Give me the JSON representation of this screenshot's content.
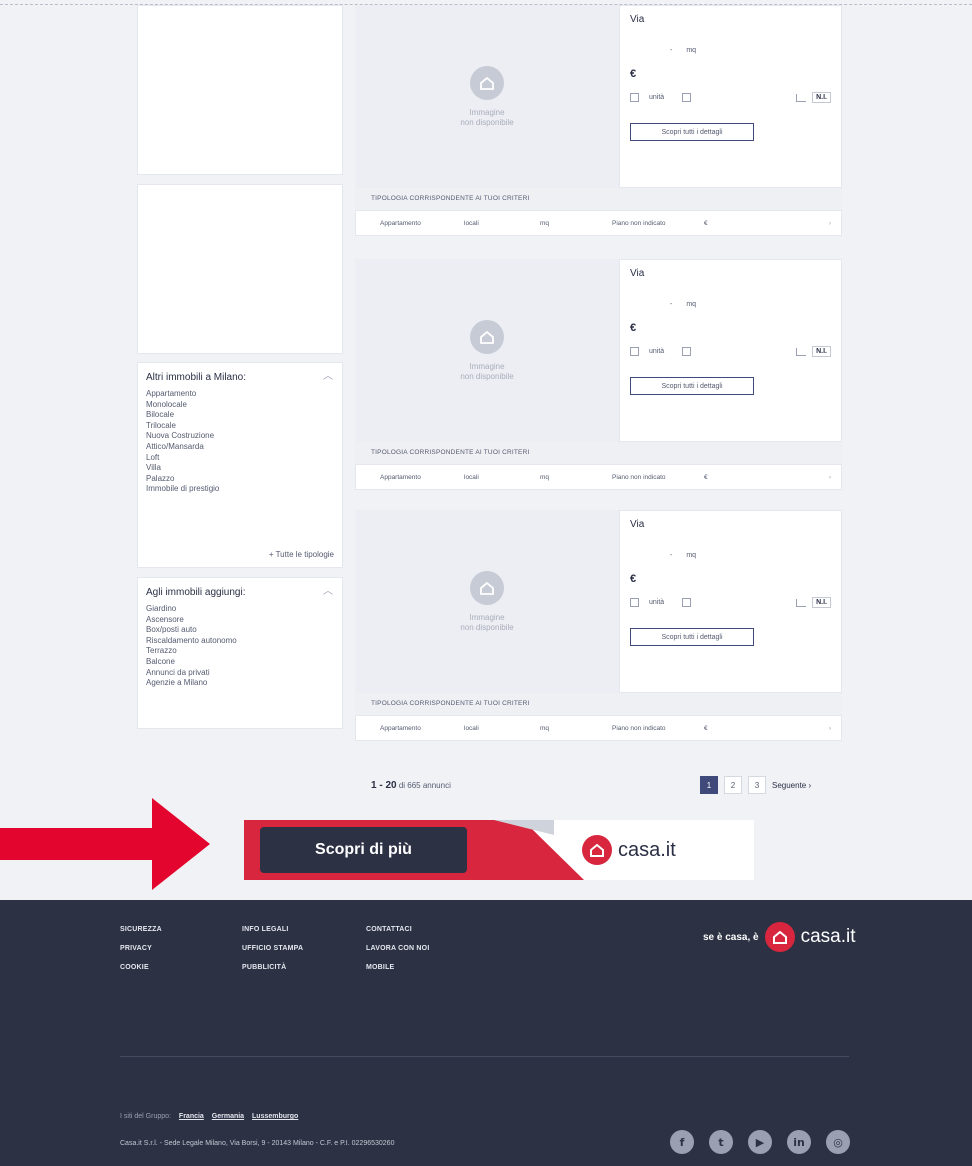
{
  "listing_labels": {
    "no_image_line1": "Immagine",
    "no_image_line2": "non disponibile",
    "street": "Via",
    "size_sep": "-",
    "size_unit": "mq",
    "price_symbol": "€",
    "units": "unità",
    "energy_class": "N.I.",
    "details_button": "Scopri tutti i dettagli",
    "criteria_header": "TIPOLOGIA CORRISPONDENTE AI TUOI CRITERI",
    "criteria_row": [
      "Appartamento",
      "locali",
      "mq",
      "Piano non indicato",
      "€",
      "›"
    ]
  },
  "sidebar": {
    "other_properties": {
      "title": "Altri immobili a Milano:",
      "items": [
        "Appartamento",
        "Monolocale",
        "Bilocale",
        "Trilocale",
        "Nuova Costruzione",
        "Attico/Mansarda",
        "Loft",
        "Villa",
        "Palazzo",
        "Immobile di prestigio"
      ],
      "all_types_link": "+ Tutte le tipologie"
    },
    "add_to_properties": {
      "title": "Agli immobili aggiungi:",
      "items": [
        "Giardino",
        "Ascensore",
        "Box/posti auto",
        "Riscaldamento autonomo",
        "Terrazzo",
        "Balcone",
        "Annunci da privati",
        "Agenzie a Milano"
      ]
    }
  },
  "pagination": {
    "range": "1 - 20",
    "total_text": "di 665 annunci",
    "pages": [
      "1",
      "2",
      "3"
    ],
    "next": "Seguente ›"
  },
  "banner": {
    "cta": "Scopri di più",
    "brand": "casa.it"
  },
  "footer": {
    "links": [
      "SICUREZZA",
      "INFO LEGALI",
      "CONTATTACI",
      "PRIVACY",
      "UFFICIO STAMPA",
      "LAVORA CON NOI",
      "COOKIE",
      "PUBBLICITÀ",
      "MOBILE"
    ],
    "tagline": "se è casa, è",
    "brand": "casa.it",
    "group_label": "I siti del Gruppo:",
    "group_sites": [
      "Francia",
      "Germania",
      "Lussemburgo"
    ],
    "legal": "Casa.it S.r.l. - Sede Legale Milano, Via Borsi, 9 - 20143 Milano - C.F. e P.I. 02296530260",
    "social_icons": [
      "facebook-icon",
      "twitter-icon",
      "youtube-icon",
      "linkedin-icon",
      "instagram-icon"
    ]
  },
  "colors": {
    "brand_red": "#d7263d",
    "navy": "#2c3144",
    "page_bg": "#f0f2f6",
    "arrow_red": "#e3052d"
  }
}
